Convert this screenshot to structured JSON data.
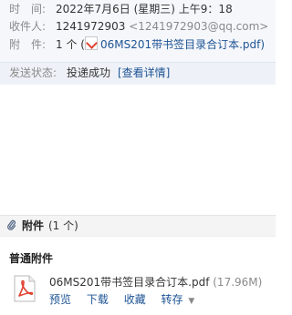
{
  "meta": {
    "time_label": "时　间:",
    "time_value": "2022年7月6日 (星期三) 上午9：18",
    "recipient_label": "收件人:",
    "recipient_name": "1241972903",
    "recipient_email": "<1241972903@qq.com>",
    "attachment_label": "附　件:",
    "attachment_count": "1 个 (",
    "attachment_file": "06MS201带书签目录合订本.pdf)"
  },
  "status": {
    "label": "发送状态:",
    "value": "投递成功",
    "details_link": "[查看详情]"
  },
  "attachments": {
    "title": "附件",
    "count": "(1 个)",
    "section_title": "普通附件",
    "files": [
      {
        "name": "06MS201带书签目录合订本.pdf",
        "size": "(17.96M)",
        "actions": [
          "预览",
          "下载",
          "收藏",
          "转存"
        ],
        "icon": "pdf-icon"
      }
    ]
  },
  "colors": {
    "header_bg": "#f6f7fb",
    "status_bg": "#eef2f8",
    "link": "#1e5494",
    "pdf_red": "#e0402e"
  }
}
